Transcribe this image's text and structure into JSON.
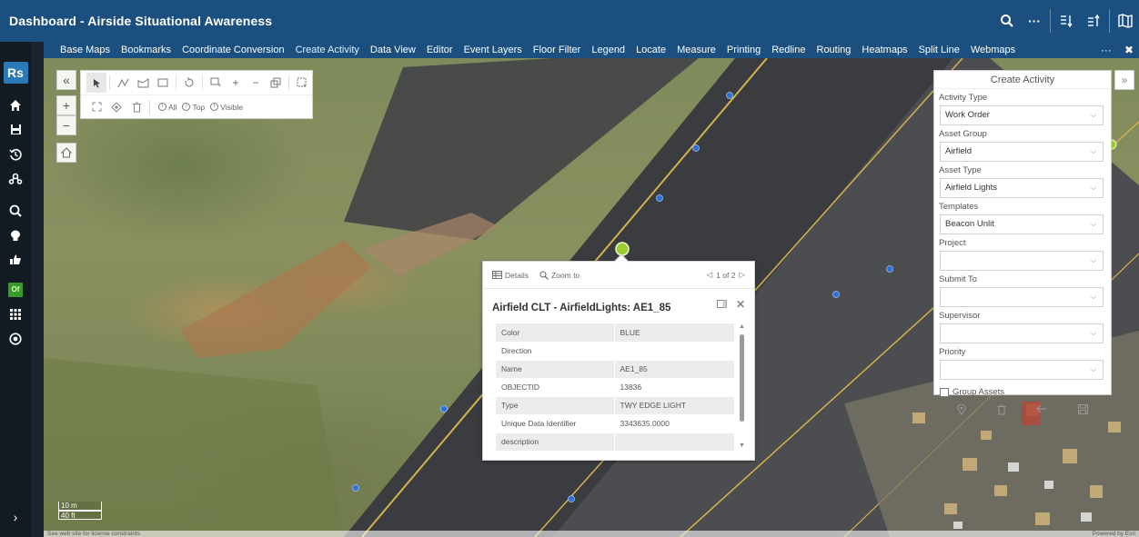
{
  "header": {
    "title": "Dashboard - Airside Situational Awareness",
    "icons": [
      "search-icon",
      "more-icon",
      "sort-descending-icon",
      "sort-ascending-icon",
      "map-book-icon"
    ]
  },
  "sidebar": {
    "logo": "Rs",
    "items": [
      "home-icon",
      "save-icon",
      "history-icon",
      "users-icon",
      "zoom-search-icon",
      "lightbulb-icon",
      "thumbs-up-icon",
      "green-app-icon",
      "apps-grid-icon",
      "settings-circle-icon"
    ],
    "green_label": "Of",
    "expand": "›"
  },
  "widgets": {
    "items": [
      "Base Maps",
      "Bookmarks",
      "Coordinate Conversion",
      "Create Activity",
      "Data View",
      "Editor",
      "Event Layers",
      "Floor Filter",
      "Legend",
      "Locate",
      "Measure",
      "Printing",
      "Redline",
      "Routing",
      "Heatmaps",
      "Split Line",
      "Webmaps"
    ],
    "active": "Create Activity",
    "more": "···",
    "close": "✖"
  },
  "selection_toolbar": {
    "all": "All",
    "top": "Top",
    "visible": "Visible"
  },
  "popup": {
    "details": "Details",
    "zoom_to": "Zoom to",
    "pager": "1 of 2",
    "title": "Airfield CLT - AirfieldLights: AE1_85",
    "rows": [
      {
        "key": "Color",
        "value": "BLUE"
      },
      {
        "key": "Direction",
        "value": ""
      },
      {
        "key": "Name",
        "value": "AE1_85"
      },
      {
        "key": "OBJECTID",
        "value": "13836"
      },
      {
        "key": "Type",
        "value": "TWY EDGE LIGHT"
      },
      {
        "key": "Unique Data Identifier",
        "value": "3343635.0000"
      },
      {
        "key": "description",
        "value": ""
      }
    ]
  },
  "create_activity": {
    "title": "Create Activity",
    "fields": [
      {
        "label": "Activity Type",
        "value": "Work Order"
      },
      {
        "label": "Asset Group",
        "value": "Airfield"
      },
      {
        "label": "Asset Type",
        "value": "Airfield Lights"
      },
      {
        "label": "Templates",
        "value": "Beacon Unlit"
      },
      {
        "label": "Project",
        "value": ""
      },
      {
        "label": "Submit To",
        "value": ""
      },
      {
        "label": "Supervisor",
        "value": ""
      },
      {
        "label": "Priority",
        "value": ""
      }
    ],
    "group_assets": "Group Assets"
  },
  "map": {
    "scale_metric": "10 m",
    "scale_imperial": "40 ft",
    "attribution": "See web site for license constraints",
    "powered_by": "Powered by Esri"
  },
  "colors": {
    "header": "#1b4f7f",
    "sidebar": "#121a22",
    "light_point": "#2f6fd6",
    "selected_point": "#9acd32"
  }
}
